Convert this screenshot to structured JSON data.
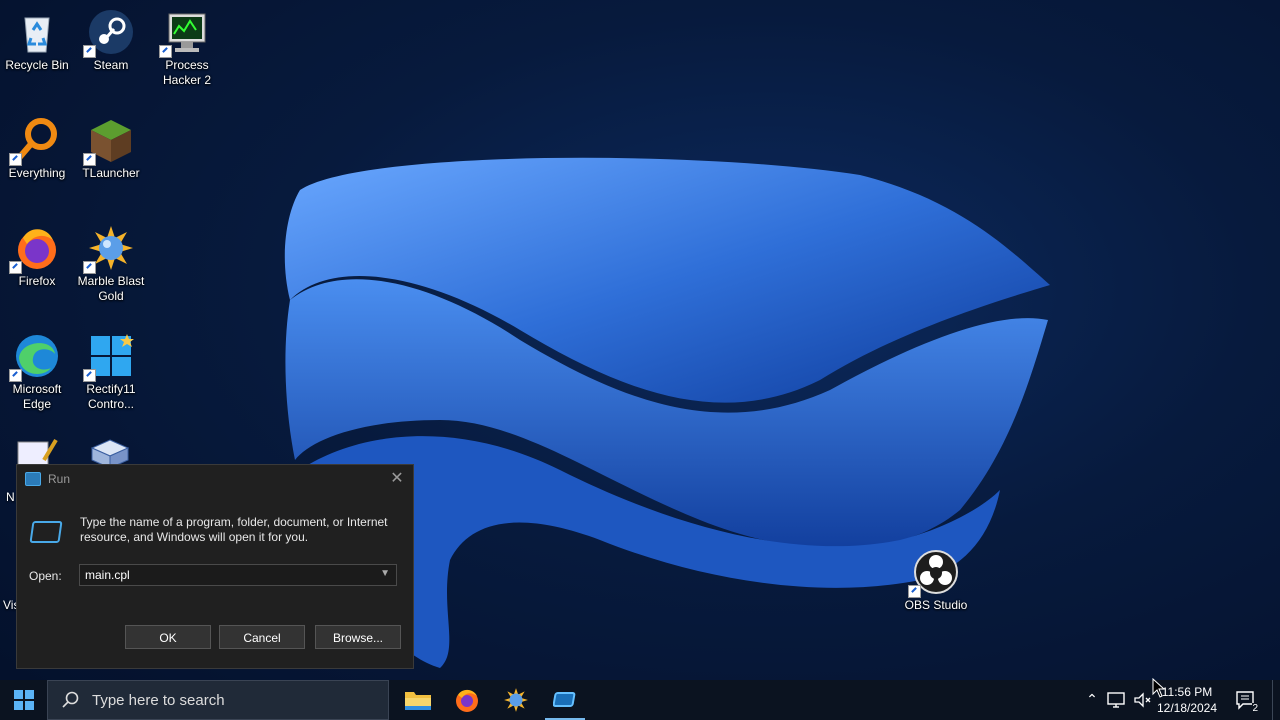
{
  "desktop": {
    "icons": [
      {
        "label": "Recycle Bin",
        "icon": "recycle-bin-icon"
      },
      {
        "label": "Steam",
        "icon": "steam-icon"
      },
      {
        "label": "Process\nHacker 2",
        "icon": "process-hacker-icon"
      },
      {
        "label": "Everything",
        "icon": "everything-search-icon"
      },
      {
        "label": "TLauncher",
        "icon": "tlauncher-icon"
      },
      {
        "label": "Firefox",
        "icon": "firefox-icon"
      },
      {
        "label": "Marble Blast\nGold",
        "icon": "marble-blast-icon"
      },
      {
        "label": "Microsoft\nEdge",
        "icon": "edge-icon"
      },
      {
        "label": "Rectify11\nContro...",
        "icon": "rectify11-icon"
      },
      {
        "label": "OBS Studio",
        "icon": "obs-icon"
      }
    ],
    "peek_labels": [
      "N",
      "Vis"
    ]
  },
  "run_dialog": {
    "title": "Run",
    "description": "Type the name of a program, folder, document, or Internet resource, and Windows will open it for you.",
    "open_label": "Open:",
    "open_value": "main.cpl",
    "ok_label": "OK",
    "cancel_label": "Cancel",
    "browse_label": "Browse..."
  },
  "taskbar": {
    "search_placeholder": "Type here to search",
    "apps": [
      "file-explorer-icon",
      "firefox-icon",
      "marble-blast-icon",
      "run-icon"
    ],
    "clock_time": "11:56 PM",
    "clock_date": "12/18/2024",
    "notification_count": "2"
  },
  "colors": {
    "accent": "#76b9ed",
    "dialog_bg": "#202020",
    "taskbar_bg": "#0b1320"
  }
}
